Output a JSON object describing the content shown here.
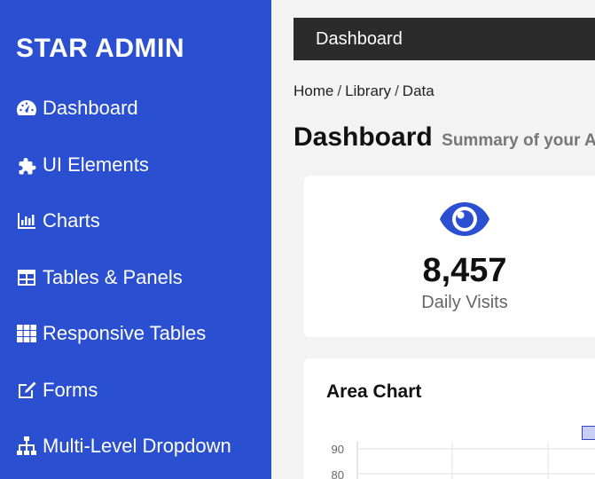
{
  "sidebar": {
    "brand": "STAR ADMIN",
    "items": [
      {
        "label": "Dashboard",
        "icon": "dashboard-gauge-icon"
      },
      {
        "label": "UI Elements",
        "icon": "puzzle-icon"
      },
      {
        "label": "Charts",
        "icon": "bar-chart-icon"
      },
      {
        "label": "Tables & Panels",
        "icon": "table-icon"
      },
      {
        "label": "Responsive Tables",
        "icon": "grid-icon"
      },
      {
        "label": "Forms",
        "icon": "edit-icon"
      },
      {
        "label": "Multi-Level Dropdown",
        "icon": "sitemap-icon"
      }
    ]
  },
  "topbar": {
    "title": "Dashboard"
  },
  "breadcrumb": {
    "items": [
      "Home",
      "Library",
      "Data"
    ],
    "separator": "/"
  },
  "heading": {
    "title": "Dashboard",
    "subtitle": "Summary of your A"
  },
  "stat": {
    "value": "8,457",
    "label": "Daily Visits",
    "icon": "eye-icon"
  },
  "chart": {
    "title": "Area Chart",
    "y_ticks": [
      "90",
      "80"
    ]
  },
  "colors": {
    "sidebar_bg": "#2b4fd1",
    "topbar_bg": "#2b2b2b",
    "accent": "#2b4fd1",
    "legend_fill": "#c9cdf7",
    "legend_border": "#3341c8"
  }
}
